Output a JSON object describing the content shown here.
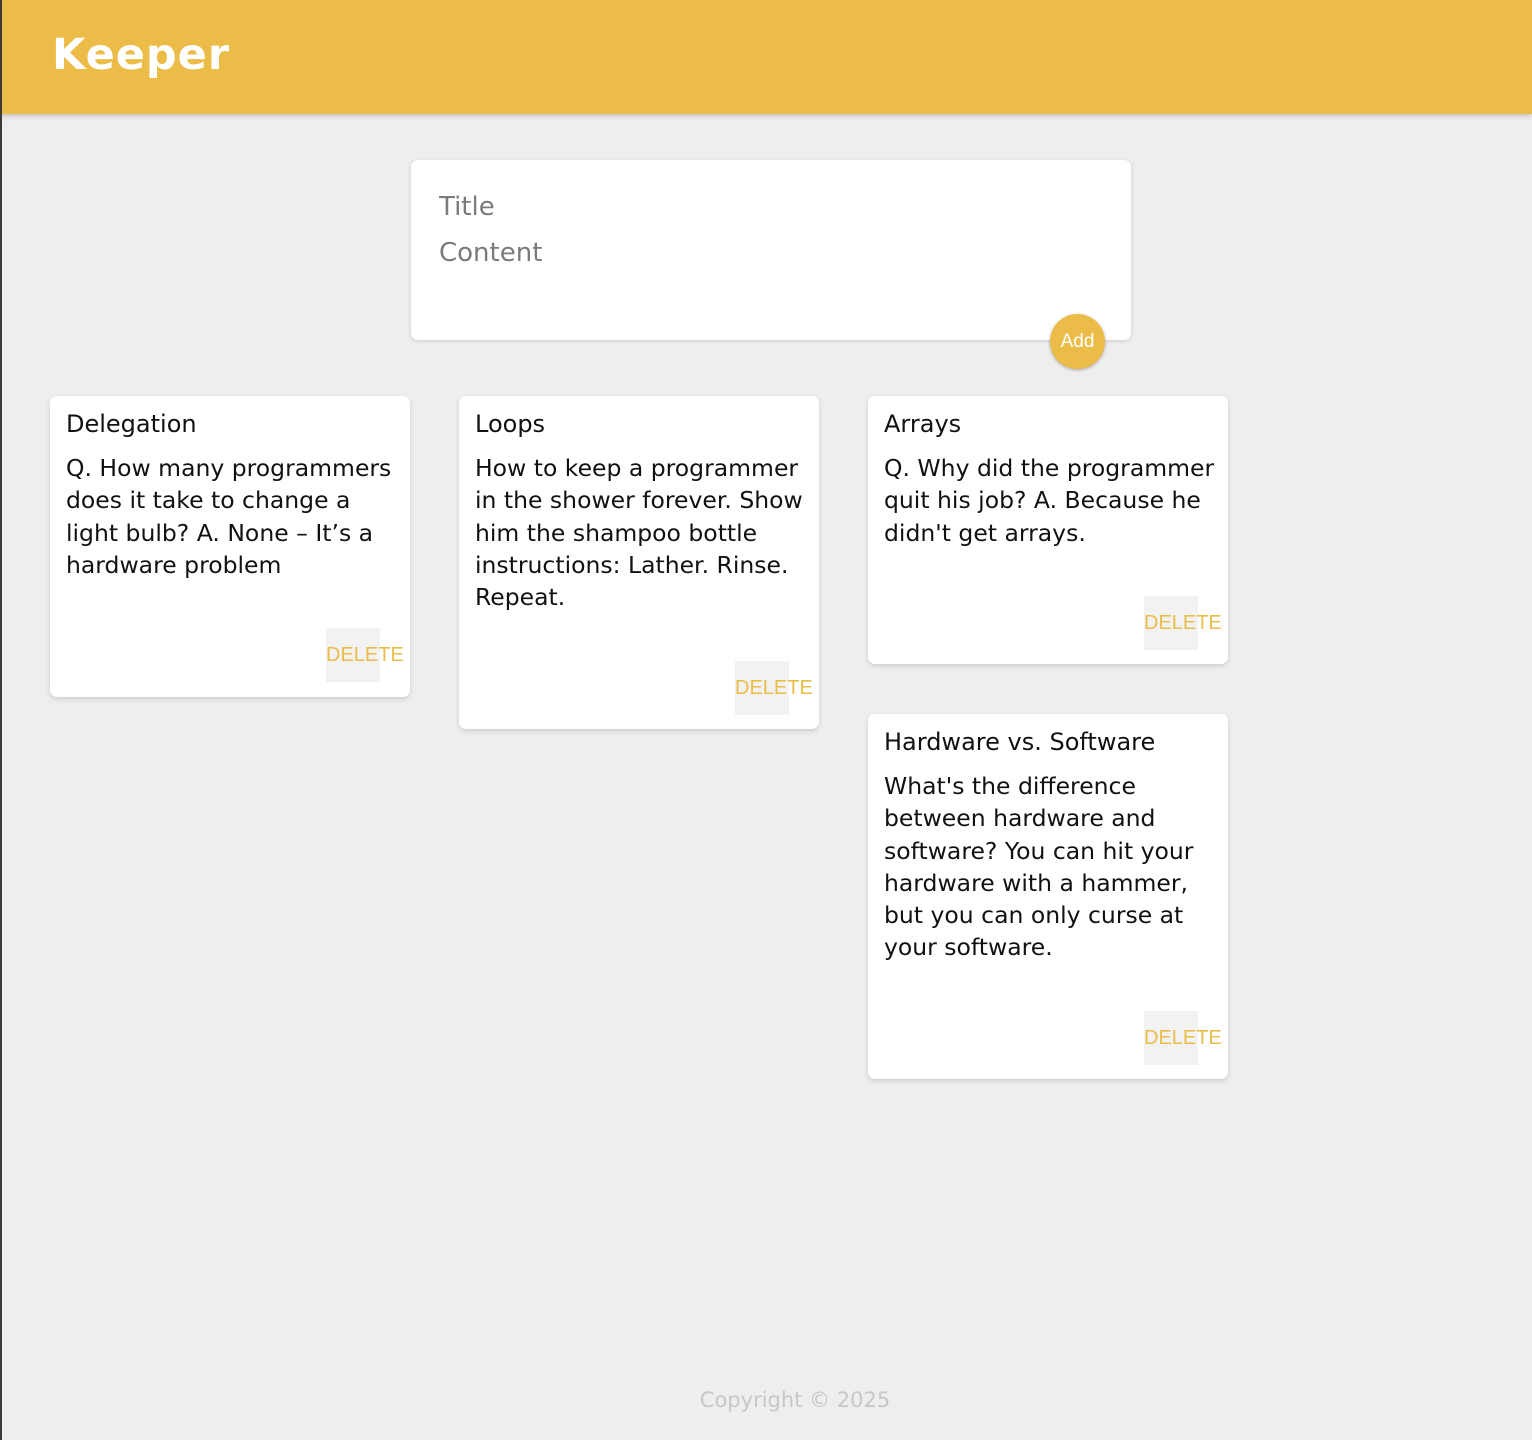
{
  "header": {
    "title": "Keeper"
  },
  "create_form": {
    "title_placeholder": "Title",
    "content_placeholder": "Content",
    "add_label": "Add"
  },
  "notes": [
    {
      "title": "Delegation",
      "content": "Q. How many programmers does it take to change a light bulb? A. None – It’s a hardware problem",
      "delete_label": "DELETE"
    },
    {
      "title": "Loops",
      "content": "How to keep a programmer in the shower forever. Show him the shampoo bottle instructions: Lather. Rinse. Repeat.",
      "delete_label": "DELETE"
    },
    {
      "title": "Arrays",
      "content": "Q. Why did the programmer quit his job? A. Because he didn't get arrays.",
      "delete_label": "DELETE"
    },
    {
      "title": "Hardware vs. Software",
      "content": "What's the difference between hardware and software? You can hit your hardware with a hammer, but you can only curse at your software.",
      "delete_label": "DELETE"
    }
  ],
  "footer": {
    "copyright": "Copyright © 2025"
  },
  "colors": {
    "accent": "#ecbc48",
    "background": "#eeeeee",
    "card": "#ffffff",
    "footer_text": "#c7c7c7"
  }
}
